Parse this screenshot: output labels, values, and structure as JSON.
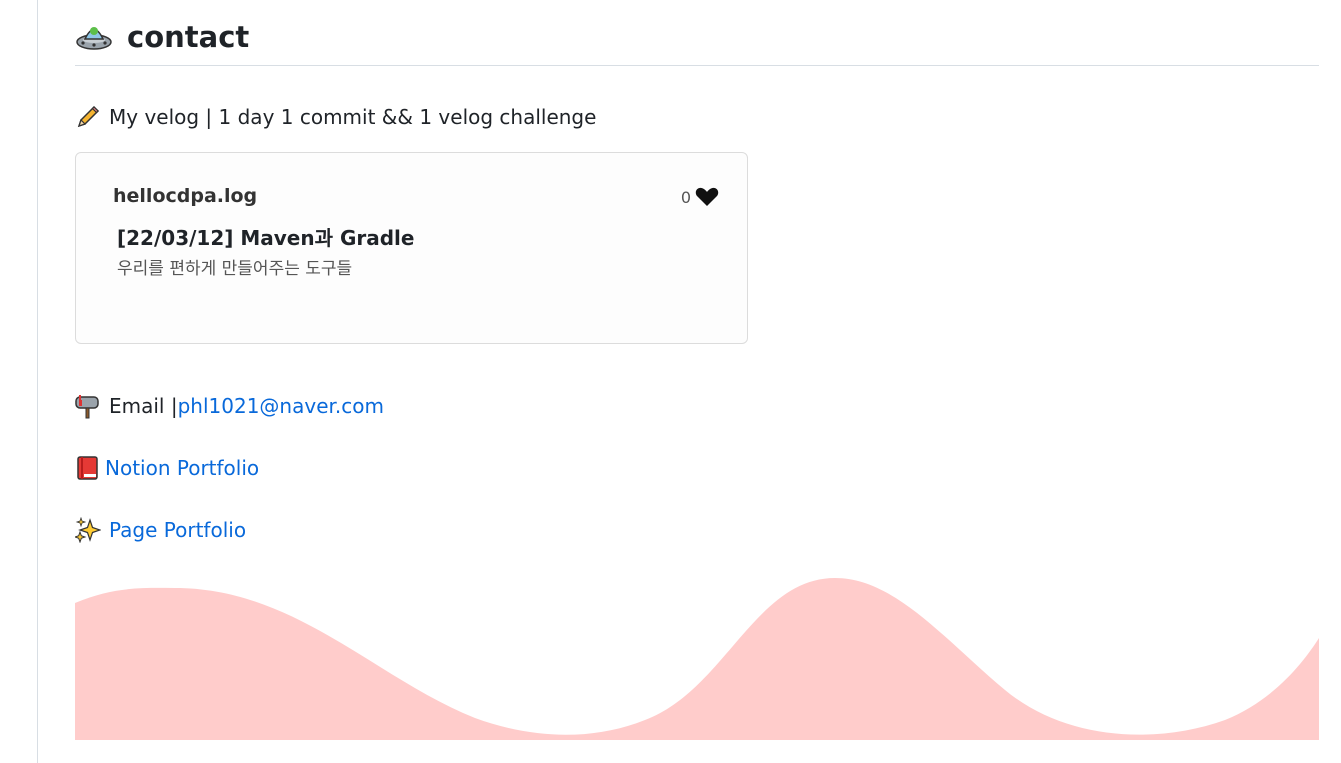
{
  "section": {
    "title": "contact",
    "title_icon": "ufo-icon"
  },
  "velog": {
    "icon": "pencil-icon",
    "label": "My velog | 1 day 1 commit && 1 velog challenge"
  },
  "card": {
    "author": "hellocdpa.log",
    "likes": "0",
    "like_icon": "heart-icon",
    "post_title": "[22/03/12] Maven과 Gradle",
    "post_description": "우리를 편하게 만들어주는 도구들"
  },
  "email": {
    "icon": "mailbox-icon",
    "label": "Email | ",
    "address": "phl1021@naver.com"
  },
  "notion": {
    "icon": "book-icon",
    "label": "Notion Portfolio"
  },
  "page_portfolio": {
    "icon": "sparkles-icon",
    "label": "Page Portfolio"
  },
  "colors": {
    "wave": "#ffcccb",
    "link": "#0969da"
  }
}
